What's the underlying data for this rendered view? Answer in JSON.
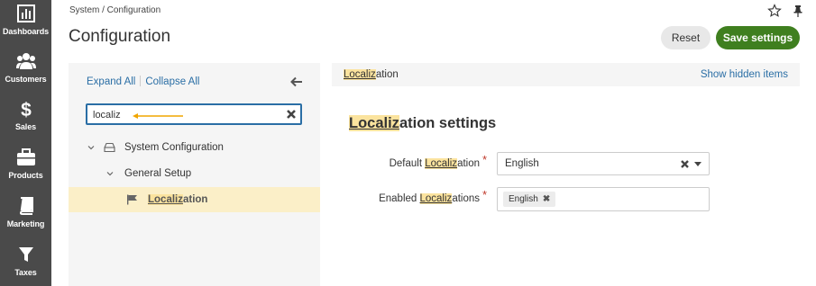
{
  "nav": {
    "items": [
      {
        "label": "Dashboards",
        "icon": "bar-chart-icon"
      },
      {
        "label": "Customers",
        "icon": "users-icon"
      },
      {
        "label": "Sales",
        "icon": "dollar-icon"
      },
      {
        "label": "Products",
        "icon": "briefcase-icon"
      },
      {
        "label": "Marketing",
        "icon": "book-icon"
      },
      {
        "label": "Taxes",
        "icon": "filter-icon"
      }
    ]
  },
  "header": {
    "breadcrumb": "System / Configuration",
    "title": "Configuration",
    "reset_label": "Reset",
    "save_label": "Save settings",
    "icons": [
      "star-icon",
      "pin-icon"
    ]
  },
  "tree": {
    "expand_all": "Expand All",
    "collapse_all": "Collapse All",
    "search_value": "localiz",
    "nodes": [
      {
        "label": "System Configuration",
        "icon": "drive-icon",
        "expanded": true
      },
      {
        "label": "General Setup",
        "expanded": true
      },
      {
        "label_hl": "Localiz",
        "label_rest": "ation",
        "icon": "flag-icon",
        "selected": true
      }
    ]
  },
  "content": {
    "crumb_hl": "Localiz",
    "crumb_rest": "ation",
    "show_hidden": "Show hidden items",
    "section_hl": "Localiz",
    "section_rest": "ation settings",
    "fields": {
      "default": {
        "label_pre": "Default ",
        "label_hl": "Localiz",
        "label_post": "ation",
        "required": "*",
        "value": "English"
      },
      "enabled": {
        "label_pre": "Enabled ",
        "label_hl": "Localiz",
        "label_post": "ations",
        "required": "*",
        "chips": [
          "English"
        ]
      }
    }
  },
  "colors": {
    "nav_bg": "#4a4a4a",
    "link": "#2a6ea5",
    "save_button": "#3f7f1f",
    "highlight": "#fbe39e",
    "selected_row": "#fbefc8",
    "search_arrow": "#f0a500"
  }
}
